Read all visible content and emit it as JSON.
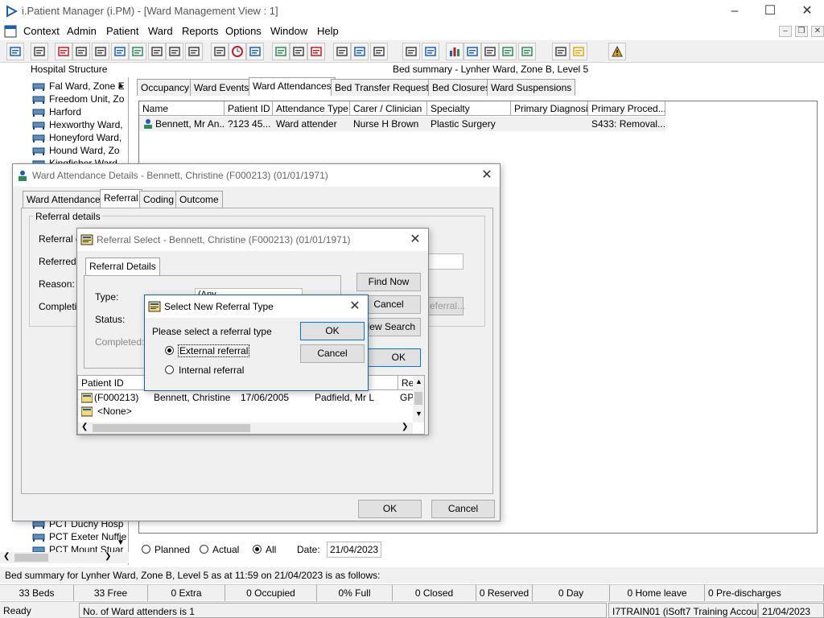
{
  "app": {
    "title": "i.Patient Manager (i.PM) - [Ward Management View : 1]",
    "accent": "#1a5fb4"
  },
  "window_controls": [
    "minimize-icon",
    "maximize-icon",
    "close-icon"
  ],
  "menu": [
    "Context",
    "Admin",
    "Patient",
    "Ward",
    "Reports",
    "Options",
    "Window",
    "Help"
  ],
  "toolbar_icons": [
    "patient-icon",
    "printer-icon",
    "book-icon",
    "edit-icon",
    "fax-icon",
    "m-icon",
    "person-icon",
    "notes-icon",
    "transfer-icon",
    "bed-icon",
    "report-icon",
    "clock-icon",
    "monitor-icon",
    "chart-icon",
    "note-icon",
    "clock2-icon",
    "list-icon",
    "bed2-icon",
    "ward-icon",
    "discharge-icon",
    "document-icon",
    "bar-chart-icon",
    "network-icon",
    "comment-icon",
    "flag-icon",
    "arrow-icon",
    "grid-icon",
    "swap-icon",
    "warning-icon",
    "exit-icon"
  ],
  "left_panel": {
    "title": "Hospital Structure",
    "items": [
      "Fal Ward, Zone E",
      "Freedom Unit, Zo",
      "Harford",
      "Hexworthy Ward,",
      "Honeyford Ward,",
      "Hound Ward, Zo",
      "Kingfisher Ward",
      "PCT Duchy Hosp",
      "PCT Exeter Nuffie",
      "PCT Mount Stuar"
    ]
  },
  "right_panel": {
    "title": "Bed summary - Lynher Ward, Zone B, Level 5",
    "tabs": [
      "Occupancy",
      "Ward Events",
      "Ward Attendances",
      "Bed Transfer Requests",
      "Bed Closures",
      "Ward Suspensions"
    ],
    "active_tab": "Ward Attendances",
    "columns": [
      "Name",
      "Patient ID",
      "Attendance Type",
      "Carer / Clinician",
      "Specialty",
      "Primary Diagnosis",
      "Primary Proced..."
    ],
    "rows": [
      [
        "Bennett, Mr An...",
        "?123 45...",
        "Ward attender",
        "Nurse H Brown",
        "Plastic Surgery",
        "",
        "S433: Removal..."
      ]
    ],
    "filters": {
      "planned": "Planned",
      "actual": "Actual",
      "all": "All",
      "selected": "All",
      "date_label": "Date:",
      "date_value": "21/04/2023"
    }
  },
  "status_line": "Bed summary for Lynher Ward, Zone B, Level 5 as at 11:59 on 21/04/2023 is as follows:",
  "stats": [
    "33 Beds",
    "33 Free",
    "0 Extra",
    "0 Occupied",
    "0% Full",
    "0 Closed",
    "0 Reserved",
    "0 Day",
    "0 Home leave",
    "0 Pre-discharges"
  ],
  "status_bar": {
    "ready": "Ready",
    "message": "No. of Ward attenders is 1",
    "user": "I7TRAIN01 (iSoft7 Training Account)",
    "date": "21/04/2023"
  },
  "attendance_dialog": {
    "title": "Ward Attendance Details - Bennett, Christine (F000213) (01/01/1971)",
    "tabs": [
      "Ward Attendance",
      "Referral",
      "Coding",
      "Outcome"
    ],
    "active_tab": "Referral",
    "group_label": "Referral details",
    "labels": [
      "Referral d",
      "Referred b",
      "Reason:",
      "Completion"
    ],
    "ok": "OK",
    "cancel": "Cancel",
    "hidden_button": "eferral..."
  },
  "referral_select_dialog": {
    "title": "Referral Select - Bennett, Christine (F000213) (01/01/1971)",
    "tab": "Referral Details",
    "labels": [
      "Type:",
      "Status:",
      "Completed:"
    ],
    "type_value": "(Any",
    "buttons": [
      "Find Now",
      "Cancel",
      "New Search",
      "OK"
    ],
    "columns": [
      "Patient ID",
      "Re"
    ],
    "rows": [
      [
        "(F000213)",
        "Bennett, Christine",
        "17/06/2005",
        "Padfield, Mr L",
        "GP"
      ],
      [
        "<None>",
        "",
        "",
        "",
        ""
      ]
    ]
  },
  "referral_type_dialog": {
    "title": "Select New Referral Type",
    "prompt": "Please select a referral type",
    "options": [
      "External referral",
      "Internal referral"
    ],
    "selected": "External referral",
    "ok": "OK",
    "cancel": "Cancel"
  }
}
